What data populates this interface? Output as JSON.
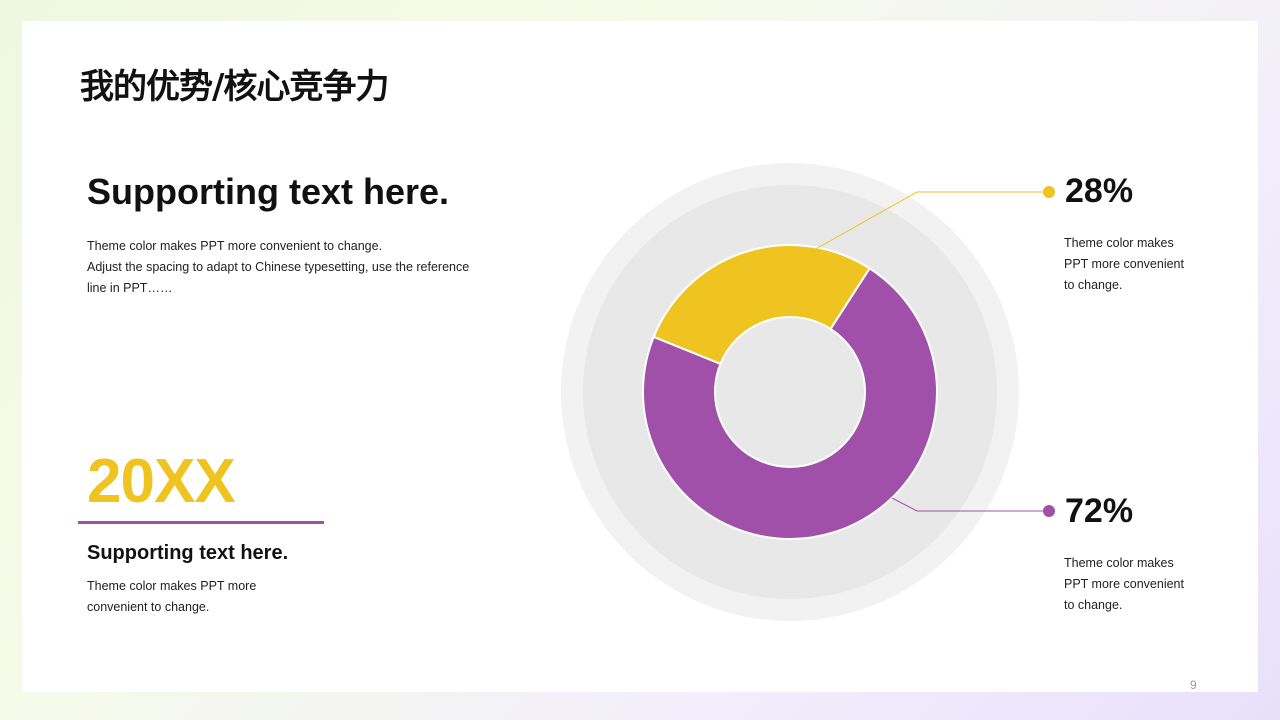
{
  "slide": {
    "title": "我的优势/核心竞争力",
    "page_number": "9"
  },
  "left_block": {
    "heading": "Supporting text here.",
    "lines": [
      "Theme color makes PPT more convenient  to change.",
      "Adjust the spacing to adapt to Chinese  typesetting, use the reference",
      "line  in PPT……"
    ]
  },
  "year_block": {
    "year": "20XX",
    "heading": "Supporting text here.",
    "lines": [
      "Theme color makes PPT more",
      "convenient  to change."
    ]
  },
  "callouts": [
    {
      "percent": "28%",
      "lines": [
        "Theme color makes",
        "PPT more convenient",
        "to change."
      ]
    },
    {
      "percent": "72%",
      "lines": [
        "Theme color makes",
        "PPT more convenient",
        "to change."
      ]
    }
  ],
  "chart_data": {
    "type": "pie",
    "variant": "donut",
    "slices": [
      {
        "label": "28%",
        "value": 28,
        "color": "#efc320"
      },
      {
        "label": "72%",
        "value": 72,
        "color": "#a050a8"
      }
    ]
  },
  "colors": {
    "accent_yellow": "#efc320",
    "accent_purple": "#a050a8"
  }
}
